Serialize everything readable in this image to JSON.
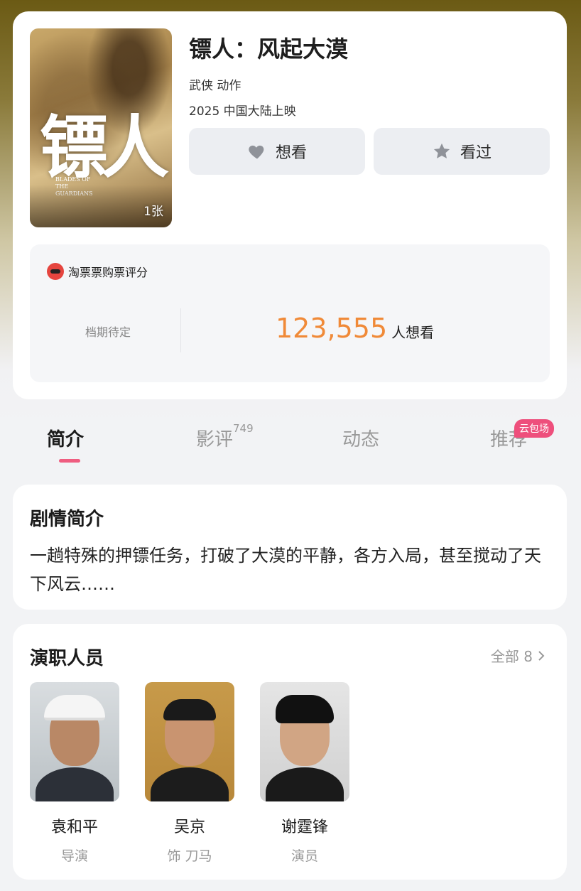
{
  "movie": {
    "title": "镖人：风起大漠",
    "genre": "武侠 动作",
    "release": "2025 中国大陆上映",
    "poster": {
      "title_char": "镖人",
      "english_title": "BLADES OF THE GUARDIANS",
      "photo_count": "1张"
    },
    "buttons": {
      "want_label": "想看",
      "seen_label": "看过"
    },
    "rating": {
      "source_label": "淘票票购票评分",
      "schedule": "档期待定",
      "want_count": "123,555",
      "want_suffix": "人想看"
    }
  },
  "tabs": [
    {
      "label": "简介",
      "active": true
    },
    {
      "label": "影评",
      "count": "749"
    },
    {
      "label": "动态"
    },
    {
      "label": "推荐",
      "badge": "云包场"
    }
  ],
  "synopsis": {
    "title": "剧情简介",
    "text": "一趟特殊的押镖任务，打破了大漠的平静，各方入局，甚至搅动了天下风云……"
  },
  "cast": {
    "title": "演职人员",
    "all_label": "全部 8",
    "people": [
      {
        "name": "袁和平",
        "role": "导演"
      },
      {
        "name": "吴京",
        "role": "饰 刀马"
      },
      {
        "name": "谢霆锋",
        "role": "演员"
      }
    ]
  },
  "colors": {
    "accent_orange": "#f08a38",
    "tab_pink": "#ef5d80",
    "badge_pink": "#ee4f7c"
  }
}
